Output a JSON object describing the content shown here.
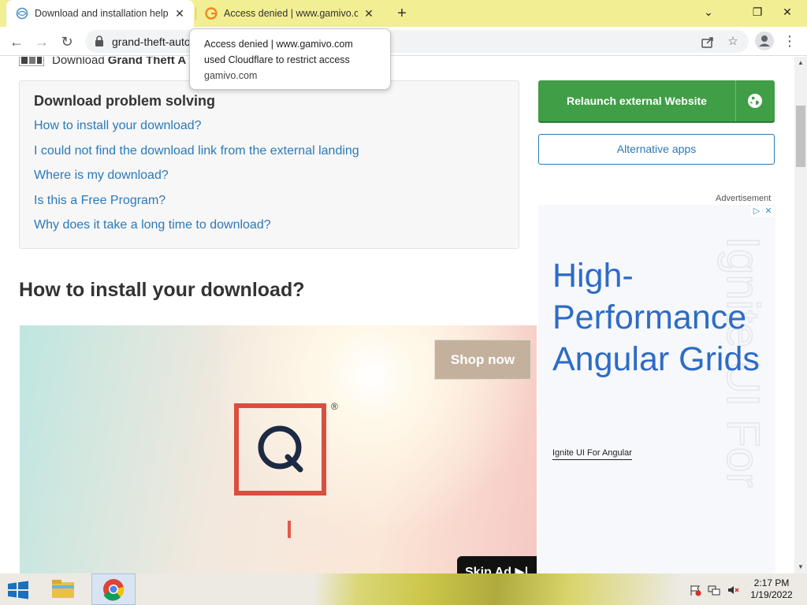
{
  "browser": {
    "tabs": [
      {
        "title": "Download and installation help",
        "active": true
      },
      {
        "title": "Access denied | www.gamivo.com",
        "active": false
      }
    ],
    "new_tab_icon": "+",
    "window_controls": {
      "minimize": "⌄",
      "restore": "❐",
      "close": "✕"
    },
    "url": "grand-theft-auto",
    "tooltip": {
      "line1": "Access denied | www.gamivo.com",
      "line2": "used Cloudflare to restrict access",
      "domain": "gamivo.com"
    }
  },
  "page": {
    "download_prefix": "Download",
    "download_name": "Grand Theft A",
    "problem_box": {
      "title": "Download problem solving",
      "links": [
        "How to install your download?",
        "I could not find the download link from the external landing",
        "Where is my download?",
        "Is this a Free Program?",
        "Why does it take a long time to download?"
      ]
    },
    "install_heading": "How to install your download?",
    "video_ad": {
      "shop_label": "Shop now",
      "registered_mark": "®",
      "skip_label": "Skip Ad"
    },
    "sidebar": {
      "relaunch_label": "Relaunch external Website",
      "alt_apps_label": "Alternative apps",
      "ad_label": "Advertisement",
      "banner": {
        "headline": "High-Performance Angular Grids",
        "sublink": "Ignite UI For Angular",
        "watermark": "Ignite UI For"
      }
    }
  },
  "taskbar": {
    "time": "2:17 PM",
    "date": "1/19/2022"
  },
  "colors": {
    "tab_strip": "#f2ee93",
    "link": "#2a79b8",
    "relaunch_green": "#3f9e46",
    "banner_blue": "#2d6cc6",
    "q_logo_red": "#d94f3f",
    "q_logo_navy": "#1c2a44"
  }
}
